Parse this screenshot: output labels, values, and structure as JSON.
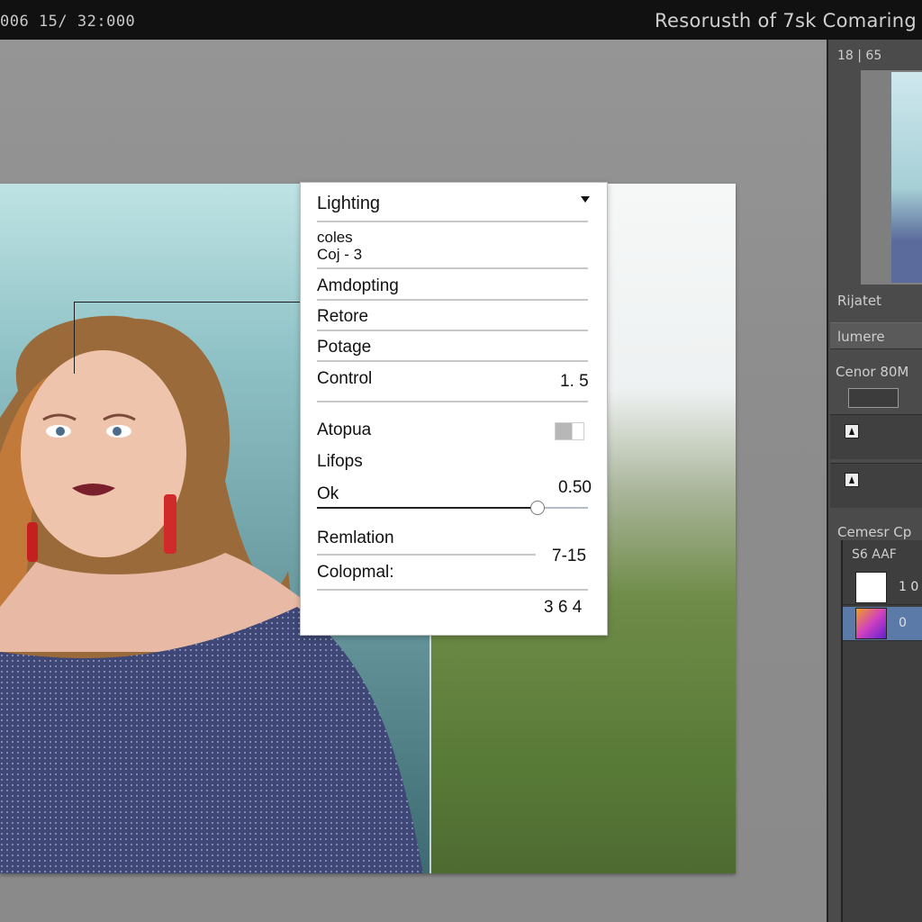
{
  "topbar": {
    "status": "006   15/  32:000",
    "title": "Resorusth of 7sk Comaring"
  },
  "canvas": {
    "description_colors": {
      "bg_left": "#8fc2c6",
      "bg_right": "#6f8c48"
    }
  },
  "panel": {
    "dropdown_label": "Lighting",
    "items": [
      {
        "label": "coles"
      },
      {
        "label": "Coj - 3"
      },
      {
        "label": "Amdopting"
      },
      {
        "label": "Retore"
      },
      {
        "label": "Potage"
      },
      {
        "label": "Control",
        "value": "1. 5"
      },
      {
        "label": "Atopua"
      },
      {
        "label": "Lifops"
      },
      {
        "label": "Ok",
        "value": "0.50"
      },
      {
        "label": "Remlation",
        "value": "7-15"
      },
      {
        "label": "Colopmal:"
      },
      {
        "value": "3 6 4"
      }
    ],
    "slider_fraction": 0.8
  },
  "right_panel": {
    "header": "18 | 65",
    "thumb_label": "Rijatet",
    "section_label": "lumere",
    "control_label": "Cenor  80M",
    "layers_header": "Cemesr  Cp",
    "layers_sub": "S6 AAF",
    "layers": [
      {
        "value": "1 0",
        "thumb_color": "#ffffff"
      },
      {
        "value": "0",
        "thumb_color": "#d040c0"
      }
    ],
    "accent": "#5c7aa8"
  }
}
